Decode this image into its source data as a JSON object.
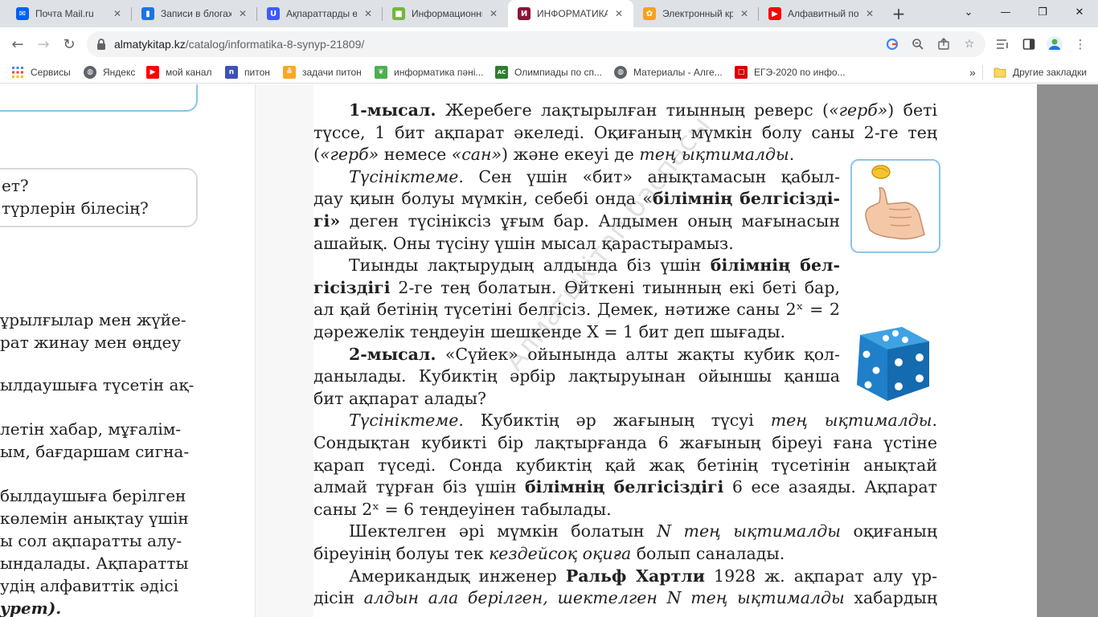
{
  "browser": {
    "tabs": [
      {
        "title": "Почта Mail.ru",
        "icon": "mail-icon",
        "color": "#005ff9",
        "glyph": "✉"
      },
      {
        "title": "Записи в блогах",
        "icon": "blog-book-icon",
        "color": "#1a73e8",
        "glyph": "▮"
      },
      {
        "title": "Ақпараттарды өлшеу",
        "icon": "u-logo-icon",
        "color": "#3d5afe",
        "glyph": "U"
      },
      {
        "title": "Информационные",
        "icon": "green-square-icon",
        "color": "#72b73a",
        "glyph": "■"
      },
      {
        "title": "ИНФОРМАТИКА",
        "icon": "textbook-icon",
        "color": "#8a1538",
        "glyph": "И",
        "active": true
      },
      {
        "title": "Электронный кр",
        "icon": "flower-icon",
        "color": "#f4a21e",
        "glyph": "✿"
      },
      {
        "title": "Алфавитный под",
        "icon": "youtube-icon",
        "color": "#ff0000",
        "glyph": "▶"
      }
    ],
    "new_tab": "+",
    "window_controls": {
      "dropdown": "⌄",
      "minimize": "—",
      "restore": "❐",
      "close": "✕"
    },
    "url": {
      "host": "almatykitap.kz",
      "path": "/catalog/informatika-8-synyp-21809/"
    },
    "bookmarks": [
      {
        "label": "Сервисы",
        "icon": "apps-grid-icon",
        "color": "#4285f4",
        "glyph": "⋮⋮"
      },
      {
        "label": "Яндекс",
        "icon": "globe-icon",
        "color": "#5f6368",
        "glyph": "◍"
      },
      {
        "label": "мой канал",
        "icon": "youtube-icon",
        "color": "#ff0000",
        "glyph": "▶"
      },
      {
        "label": "питон",
        "icon": "page-icon",
        "color": "#3f51b5",
        "glyph": "n"
      },
      {
        "label": "задачи питон",
        "icon": "python-icon",
        "color": "#f9a825",
        "glyph": "≛"
      },
      {
        "label": "информатика пәні...",
        "icon": "leaf-icon",
        "color": "#4caf50",
        "glyph": "❦"
      },
      {
        "label": "Олимпиады по сп...",
        "icon": "acmp-icon",
        "color": "#2e7d32",
        "glyph": "AC"
      },
      {
        "label": "Материалы - Алге...",
        "icon": "globe-icon",
        "color": "#5f6368",
        "glyph": "◍"
      },
      {
        "label": "ЕГЭ-2020 по инфо...",
        "icon": "red-square-icon",
        "color": "#d50000",
        "glyph": "□"
      }
    ],
    "bookmarks_overflow": "»",
    "other_bookmarks": "Другие закладки"
  },
  "page": {
    "left_lines": [
      "ет?",
      "түрлерін білесің?",
      "ұрылғылар мен жүйе-",
      "рат жинау мен өңдеу",
      "ылдаушыға түсетін ақ-",
      "летін хабар, мұғалім-",
      "ым, бағдаршам сигна-",
      "был­даушыға берілген",
      "көлемін анықтау үшін",
      "ы сол ақпаратты алу-",
      "ындалады. Ақпаратты",
      "удің алфавиттік әдісі",
      "урет)."
    ],
    "right_lines": [
      {
        "t": "1-мысал. Жеребеге лақтырылған тиынның реверс («герб») беті"
      },
      {
        "t": "түссе, 1 бит ақпарат әкеледі. Оқиғаның мүмкін болу саны 2-ге тең"
      },
      {
        "t": "(«герб» немесе «сан») және екеуі де тең ықтималды."
      },
      {
        "t": "Түсініктеме. Сен үшін «бит» анықтамасын қабыл-"
      },
      {
        "t": "дау қиын болуы мүмкін, себебі онда «білімнің белгісізді-"
      },
      {
        "t": "гі» деген түсініксіз ұғым бар. Алдымен оның мағынасын"
      },
      {
        "t": "ашайық. Оны түсіну үшін мысал қарастырамыз."
      },
      {
        "t": "Тиынды лақтырудың алдында біз үшін білімнің бел-"
      },
      {
        "t": "гісіздігі 2-ге тең болатын. Өйткені тиынның екі беті бар,"
      },
      {
        "t": "ал қай бетінің түсетіні белгісіз. Демек, нәтиже саны 2ˣ = 2"
      },
      {
        "t": "дәрежелік теңдеуін шешкенде X = 1 бит деп шығады."
      },
      {
        "t": "2-мысал. «Сүйек» ойынында алты жақты кубик қол-"
      },
      {
        "t": "данылады. Кубиктің әрбір лақтыруынан ойыншы қанша"
      },
      {
        "t": "бит ақпарат алады?"
      },
      {
        "t": "Түсініктеме. Кубиктің әр жағының түсуі тең ықтималды."
      },
      {
        "t": "Сондықтан кубикті бір лақтырғанда 6 жағының біреуі ғана үстіне"
      },
      {
        "t": "қарап түседі. Сонда кубиктің қай жақ бетінің түсетінін анықтай"
      },
      {
        "t": "алмай тұрған біз үшін білімнің белгісіздігі 6 есе азаяды. Ақпарат"
      },
      {
        "t": "саны 2ˣ = 6 теңдеуінен табылады."
      },
      {
        "t": "Шектелген әрі мүмкін болатын N тең ықтималды оқиғаның"
      },
      {
        "t": "біреуінің болуы тек кездейсоқ оқиға болып саналады."
      },
      {
        "t": "Американдық инженер Ральф Хартли 1928 ж. ақпарат алу үр-"
      },
      {
        "t": "дісін алдын ала берілген, шектелген N тең ықтималды хабардың"
      }
    ],
    "watermark": "Алматыкітап баспасы"
  }
}
